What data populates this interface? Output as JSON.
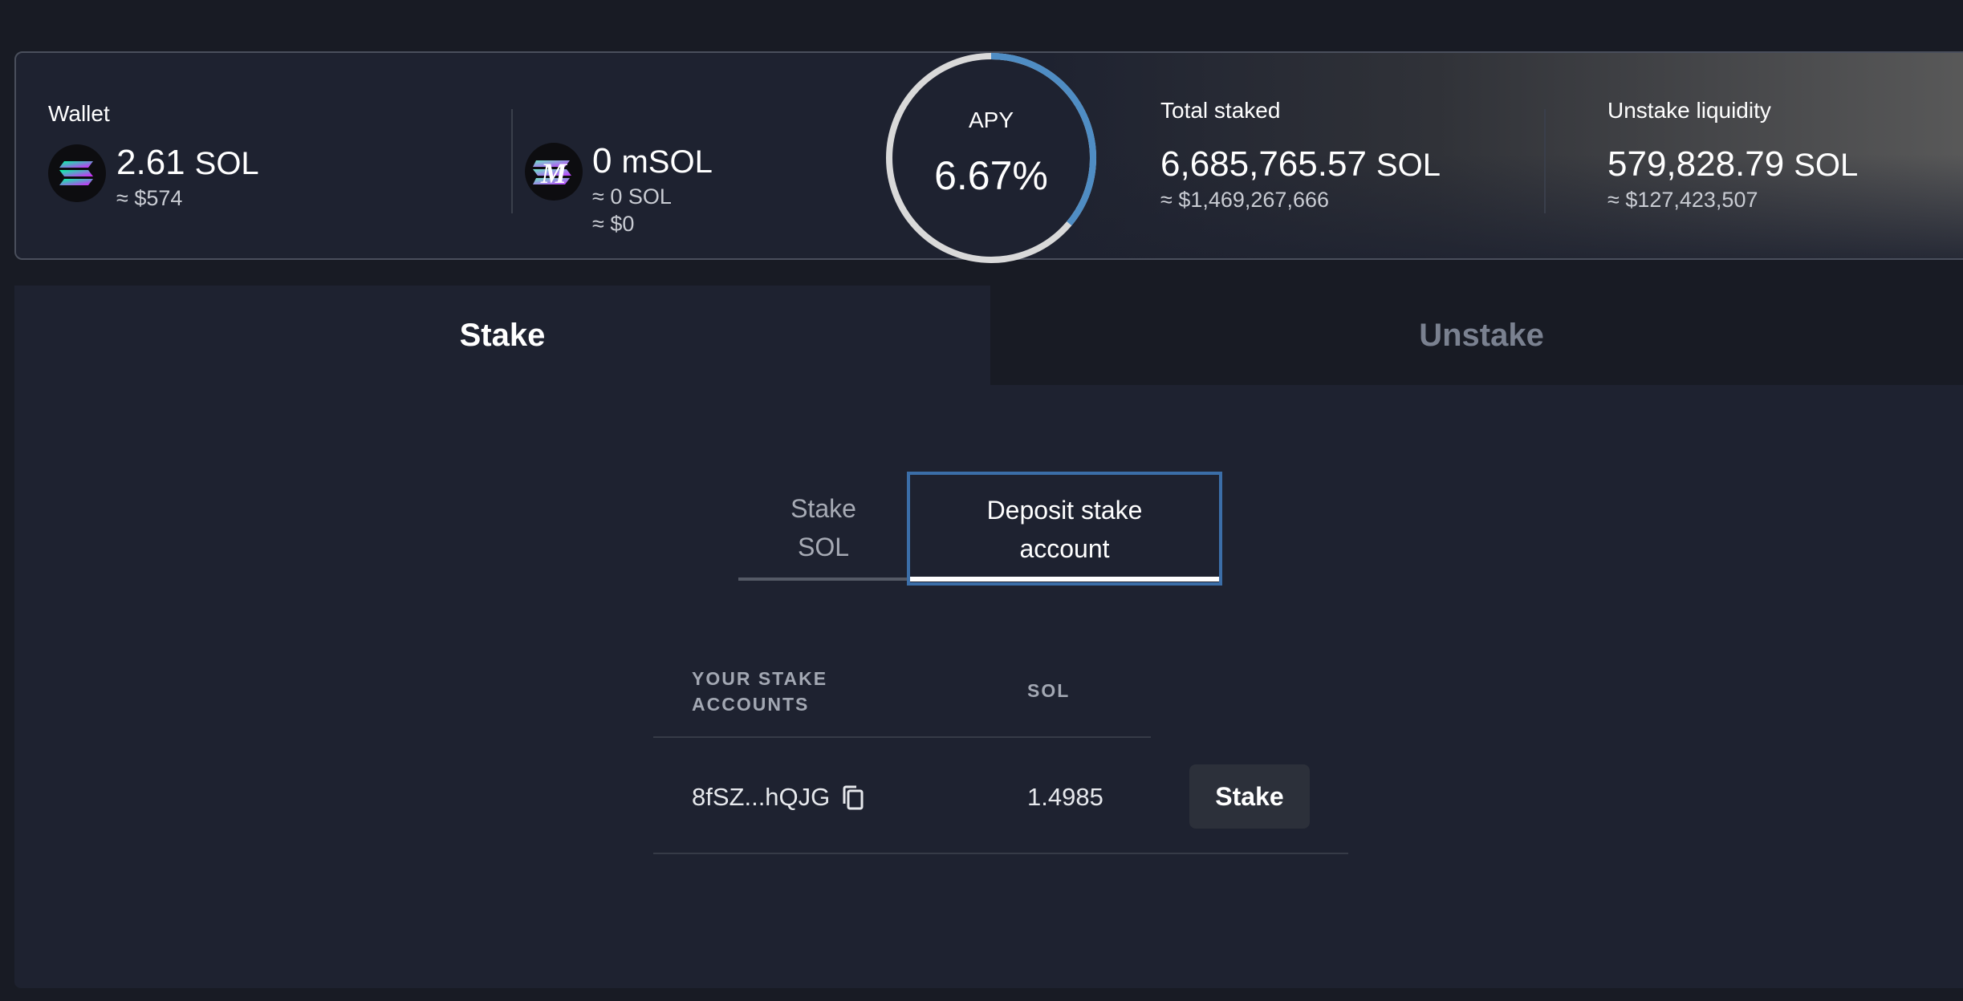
{
  "stats": {
    "wallet": {
      "label": "Wallet",
      "value": "2.61",
      "unit": "SOL",
      "usd": "≈ $574",
      "icon": "solana-icon"
    },
    "msol": {
      "value": "0",
      "unit": "mSOL",
      "sol_equiv": "≈ 0 SOL",
      "usd": "≈ $0",
      "icon": "marinade-msol-icon"
    },
    "apy": {
      "label": "APY",
      "value": "6.67%"
    },
    "total_staked": {
      "label": "Total staked",
      "value": "6,685,765.57",
      "unit": "SOL",
      "usd": "≈ $1,469,267,666"
    },
    "unstake_liquidity": {
      "label": "Unstake liquidity",
      "value": "579,828.79",
      "unit": "SOL",
      "usd": "≈ $127,423,507"
    }
  },
  "tabs": [
    {
      "label": "Stake",
      "active": true
    },
    {
      "label": "Unstake",
      "active": false
    }
  ],
  "subtabs": [
    {
      "label": "Stake SOL",
      "active": false
    },
    {
      "label": "Deposit stake account",
      "active": true
    }
  ],
  "table": {
    "headers": [
      "YOUR STAKE ACCOUNTS",
      "SOL"
    ],
    "rows": [
      {
        "account": "8fSZ...hQJG",
        "sol": "1.4985",
        "action": "Stake"
      }
    ]
  },
  "colors": {
    "background": "#181b24",
    "card": "#1e2230",
    "accent": "#3b6ea8",
    "apy_ring_progress": "#4f8dc4",
    "apy_ring_track": "#d9d9d9"
  }
}
